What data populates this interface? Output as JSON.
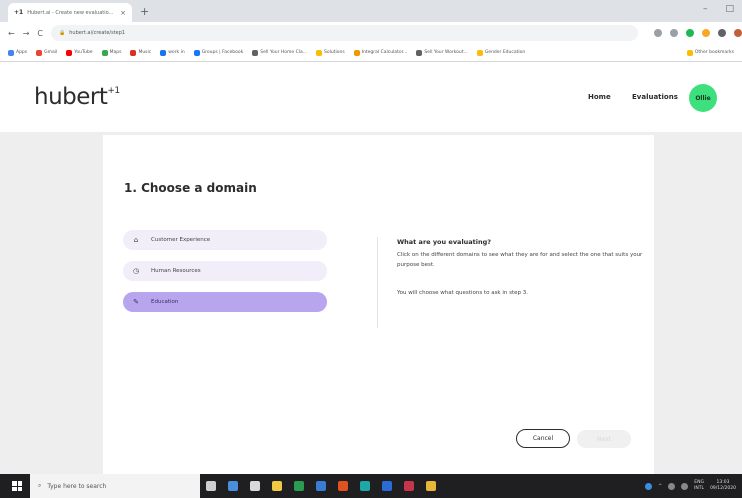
{
  "browser": {
    "tab_title": "Hubert.ai - Create new evaluatio...",
    "tab_icon": "+1",
    "tab_close": "×",
    "new_tab": "+",
    "window_controls": [
      "–",
      "□"
    ],
    "url": "hubert.ai/create/step1",
    "nav": [
      "←",
      "→",
      "C"
    ],
    "bookmarks": [
      {
        "label": "Apps",
        "color": "#4285f4"
      },
      {
        "label": "Gmail",
        "color": "#ea4335"
      },
      {
        "label": "YouTube",
        "color": "#ff0000"
      },
      {
        "label": "Maps",
        "color": "#34a853"
      },
      {
        "label": "Music",
        "color": "#d93025"
      },
      {
        "label": "work in",
        "color": "#1a73e8"
      },
      {
        "label": "Groups | Facebook",
        "color": "#1877f2"
      },
      {
        "label": "Sell Your Home Cla...",
        "color": "#5f6368"
      },
      {
        "label": "Solutions",
        "color": "#fbbc04"
      },
      {
        "label": "Integral Calculator...",
        "color": "#f29900"
      },
      {
        "label": "Sell Your Workout...",
        "color": "#5f6368"
      },
      {
        "label": "Gender Education",
        "color": "#fbbc04"
      },
      {
        "label": "Other bookmarks",
        "color": "#fbbc04"
      }
    ]
  },
  "header": {
    "logo": "hubert",
    "logo_sup": "+1",
    "nav_home": "Home",
    "nav_evaluations": "Evaluations",
    "avatar_text": "Ollie"
  },
  "main": {
    "heading": "1. Choose a domain",
    "domains": [
      {
        "icon": "briefcase-icon",
        "glyph": "⌂",
        "label": "Customer Experience"
      },
      {
        "icon": "clock-icon",
        "glyph": "◷",
        "label": "Human Resources"
      },
      {
        "icon": "pencil-icon",
        "glyph": "✎",
        "label": "Education",
        "selected": true
      }
    ],
    "info_title": "What are you evaluating?",
    "info_text": "Click on the different domains to see what they are for and select the one that suits your purpose best.",
    "info_text2": "You will choose what questions to ask in step 3.",
    "cancel_label": "Cancel",
    "next_label": "Next"
  },
  "taskbar": {
    "search_placeholder": "Type here to search",
    "lang": "ENG",
    "locale": "INTL",
    "time": "13:03",
    "date": "09/12/2020"
  },
  "colors": {
    "accent_green": "#3ee07d",
    "selected_domain": "#b7a6ed",
    "domain_bg": "#f1eef9"
  }
}
